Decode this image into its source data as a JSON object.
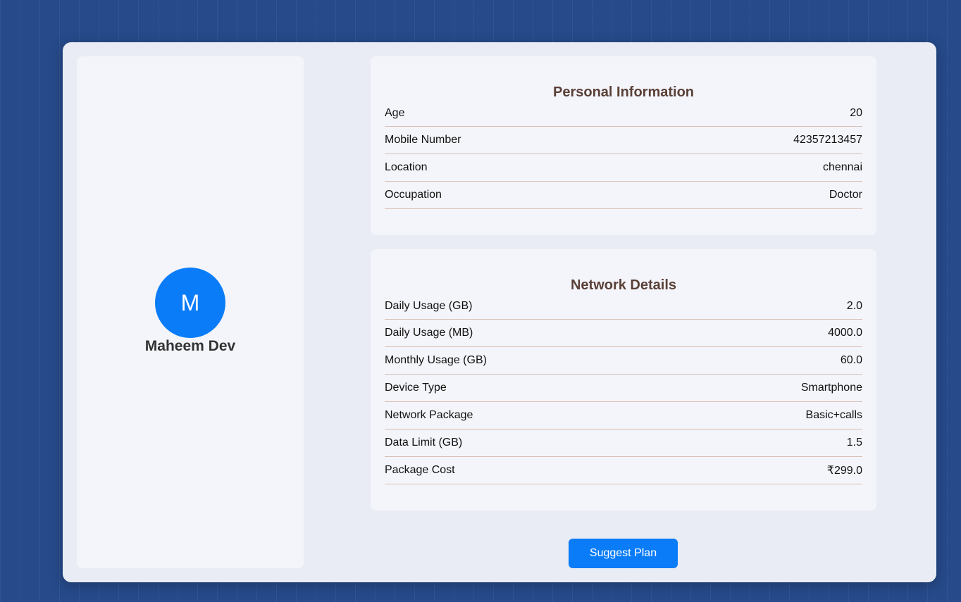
{
  "profile": {
    "avatar_initial": "M",
    "name": "Maheem Dev"
  },
  "personal_info": {
    "title": "Personal Information",
    "rows": [
      {
        "label": "Age",
        "value": "20"
      },
      {
        "label": "Mobile Number",
        "value": "42357213457"
      },
      {
        "label": "Location",
        "value": "chennai"
      },
      {
        "label": "Occupation",
        "value": "Doctor"
      }
    ]
  },
  "network_details": {
    "title": "Network Details",
    "rows": [
      {
        "label": "Daily Usage (GB)",
        "value": "2.0"
      },
      {
        "label": "Daily Usage (MB)",
        "value": "4000.0"
      },
      {
        "label": "Monthly Usage (GB)",
        "value": "60.0"
      },
      {
        "label": "Device Type",
        "value": "Smartphone"
      },
      {
        "label": "Network Package",
        "value": "Basic+calls"
      },
      {
        "label": "Data Limit (GB)",
        "value": "1.5"
      },
      {
        "label": "Package Cost",
        "value": "₹299.0"
      }
    ]
  },
  "actions": {
    "suggest_label": "Suggest Plan"
  },
  "colors": {
    "page_background": "#264a8a",
    "accent": "#0a7cf8",
    "card_title": "#5a4038",
    "row_divider": "#d8bfb3"
  }
}
